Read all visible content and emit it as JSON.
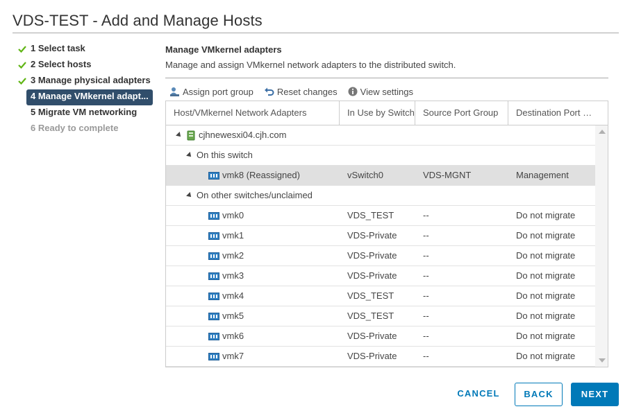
{
  "dialog": {
    "title": "VDS-TEST - Add and Manage Hosts"
  },
  "steps": [
    {
      "label": "1 Select task",
      "status": "done"
    },
    {
      "label": "2 Select hosts",
      "status": "done"
    },
    {
      "label": "3 Manage physical adapters",
      "status": "done"
    },
    {
      "label": "4 Manage VMkernel adapt...",
      "status": "active"
    },
    {
      "label": "5 Migrate VM networking",
      "status": "pending"
    },
    {
      "label": "6 Ready to complete",
      "status": "disabled"
    }
  ],
  "section": {
    "title": "Manage VMkernel adapters",
    "description": "Manage and assign VMkernel network adapters to the distributed switch."
  },
  "toolbar": {
    "assign": "Assign port group",
    "reset": "Reset changes",
    "view": "View settings"
  },
  "grid": {
    "columns": [
      "Host/VMkernel Network Adapters",
      "In Use by Switch",
      "Source Port Group",
      "Destination Port G..."
    ],
    "host": "cjhnewesxi04.cjh.com",
    "group_this": "On this switch",
    "group_other": "On other switches/unclaimed",
    "rows_this": [
      {
        "name": "vmk8 (Reassigned)",
        "switch": "vSwitch0",
        "source": "VDS-MGNT",
        "dest": "Management"
      }
    ],
    "rows_other": [
      {
        "name": "vmk0",
        "switch": "VDS_TEST",
        "source": "--",
        "dest": "Do not migrate"
      },
      {
        "name": "vmk1",
        "switch": "VDS-Private",
        "source": "--",
        "dest": "Do not migrate"
      },
      {
        "name": "vmk2",
        "switch": "VDS-Private",
        "source": "--",
        "dest": "Do not migrate"
      },
      {
        "name": "vmk3",
        "switch": "VDS-Private",
        "source": "--",
        "dest": "Do not migrate"
      },
      {
        "name": "vmk4",
        "switch": "VDS_TEST",
        "source": "--",
        "dest": "Do not migrate"
      },
      {
        "name": "vmk5",
        "switch": "VDS_TEST",
        "source": "--",
        "dest": "Do not migrate"
      },
      {
        "name": "vmk6",
        "switch": "VDS-Private",
        "source": "--",
        "dest": "Do not migrate"
      },
      {
        "name": "vmk7",
        "switch": "VDS-Private",
        "source": "--",
        "dest": "Do not migrate"
      }
    ]
  },
  "footer": {
    "cancel": "CANCEL",
    "back": "BACK",
    "next": "NEXT"
  },
  "colors": {
    "accent": "#0079b8",
    "active_step": "#314e6b",
    "check": "#60b515",
    "nic_icon": "#2f7fc1"
  }
}
